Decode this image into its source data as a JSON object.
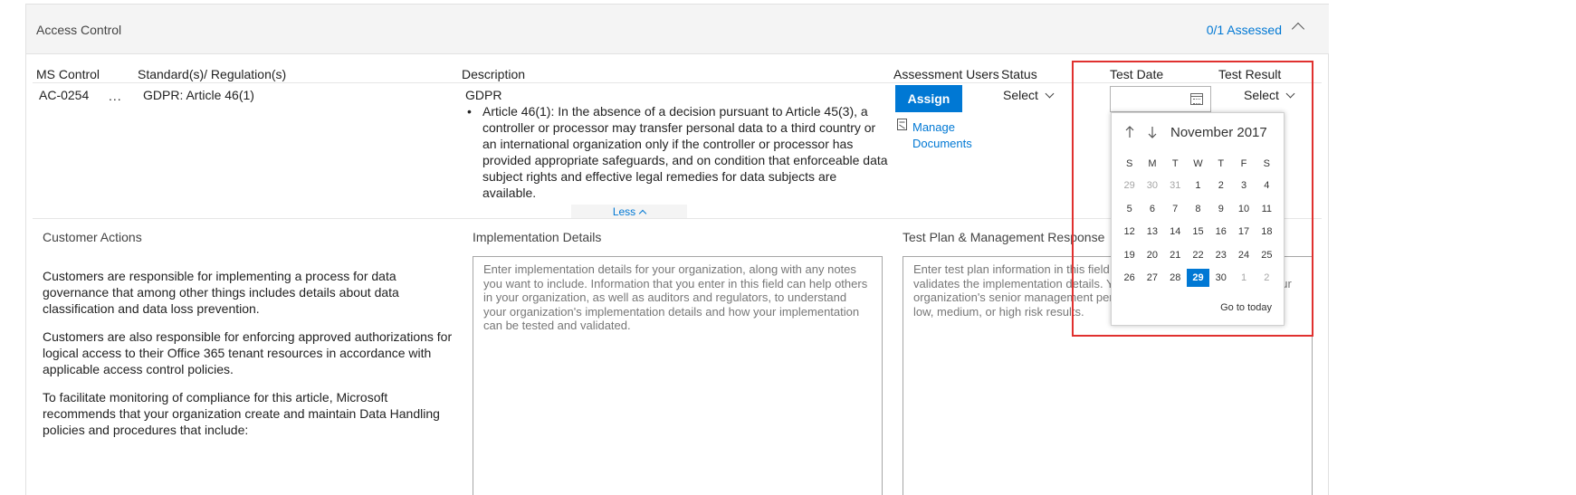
{
  "section": {
    "title": "Access Control",
    "assessed": "0/1 Assessed"
  },
  "columns": {
    "ms_control": "MS Control",
    "standards": "Standard(s)/ Regulation(s)",
    "description": "Description",
    "assessment_users": "Assessment Users",
    "status": "Status",
    "test_date": "Test Date",
    "test_result": "Test Result"
  },
  "row": {
    "control_id": "AC-0254",
    "ellipsis": "...",
    "standard": "GDPR: Article 46(1)",
    "desc_title": "GDPR",
    "desc_bullet": "•",
    "desc_body": "Article 46(1): In the absence of a decision pursuant to Article 45(3), a controller or processor may transfer personal data to a third country or an international organization only if the controller or processor has provided appropriate safeguards, and on condition that enforceable data subject rights and effective legal remedies for data subjects are available.",
    "assign_label": "Assign",
    "manage_documents": "Manage Documents",
    "status_select": "Select",
    "test_result_select": "Select",
    "less_label": "Less"
  },
  "details": {
    "customer_actions_label": "Customer Actions",
    "implementation_label": "Implementation Details",
    "testplan_label": "Test Plan & Management Response",
    "customer_paragraphs": [
      "Customers are responsible for implementing a process for data governance that among other things includes details about data classification and data loss prevention.",
      "Customers are also responsible for enforcing approved authorizations for logical access to their Office 365 tenant resources in accordance with applicable access control policies.",
      "To facilitate monitoring of compliance for this article, Microsoft recommends that your organization create and maintain Data Handling policies and procedures that include:"
    ],
    "implementation_placeholder": "Enter implementation details for your organization, along with any notes you want to include. Information that you enter in this field can help others in your organization, as well as auditors and regulators, to understand your organization's implementation details and how your implementation can be tested and validated.",
    "testplan_placeholder": "Enter test plan information in this field that validates the implementation details. Your organization's senior management personnel can review low, medium, or high risk results.",
    "testplan_visible_lines": [
      "Enter test plan information in this field t",
      "validates the implementation details. Yo",
      "organization's senior management pers",
      "low, medium, or high risk results."
    ],
    "testplan_overflow_fragment": "our"
  },
  "calendar": {
    "month_label": "November 2017",
    "weekdays": [
      "S",
      "M",
      "T",
      "W",
      "T",
      "F",
      "S"
    ],
    "weeks": [
      [
        "29",
        "30",
        "31",
        "1",
        "2",
        "3",
        "4"
      ],
      [
        "5",
        "6",
        "7",
        "8",
        "9",
        "10",
        "11"
      ],
      [
        "12",
        "13",
        "14",
        "15",
        "16",
        "17",
        "18"
      ],
      [
        "19",
        "20",
        "21",
        "22",
        "23",
        "24",
        "25"
      ],
      [
        "26",
        "27",
        "28",
        "29",
        "30",
        "1",
        "2"
      ]
    ],
    "selected_day": "29",
    "go_to_today": "Go to today"
  },
  "icons": {
    "collapse": "chevron-up-icon",
    "dropdown": "chevron-down-icon",
    "calendar": "calendar-icon",
    "document": "document-icon",
    "prev_month": "arrow-up-icon",
    "next_month": "arrow-down-icon"
  },
  "colors": {
    "accent": "#0078d4",
    "highlight": "#e0312f",
    "header_bg": "#f4f4f4"
  }
}
